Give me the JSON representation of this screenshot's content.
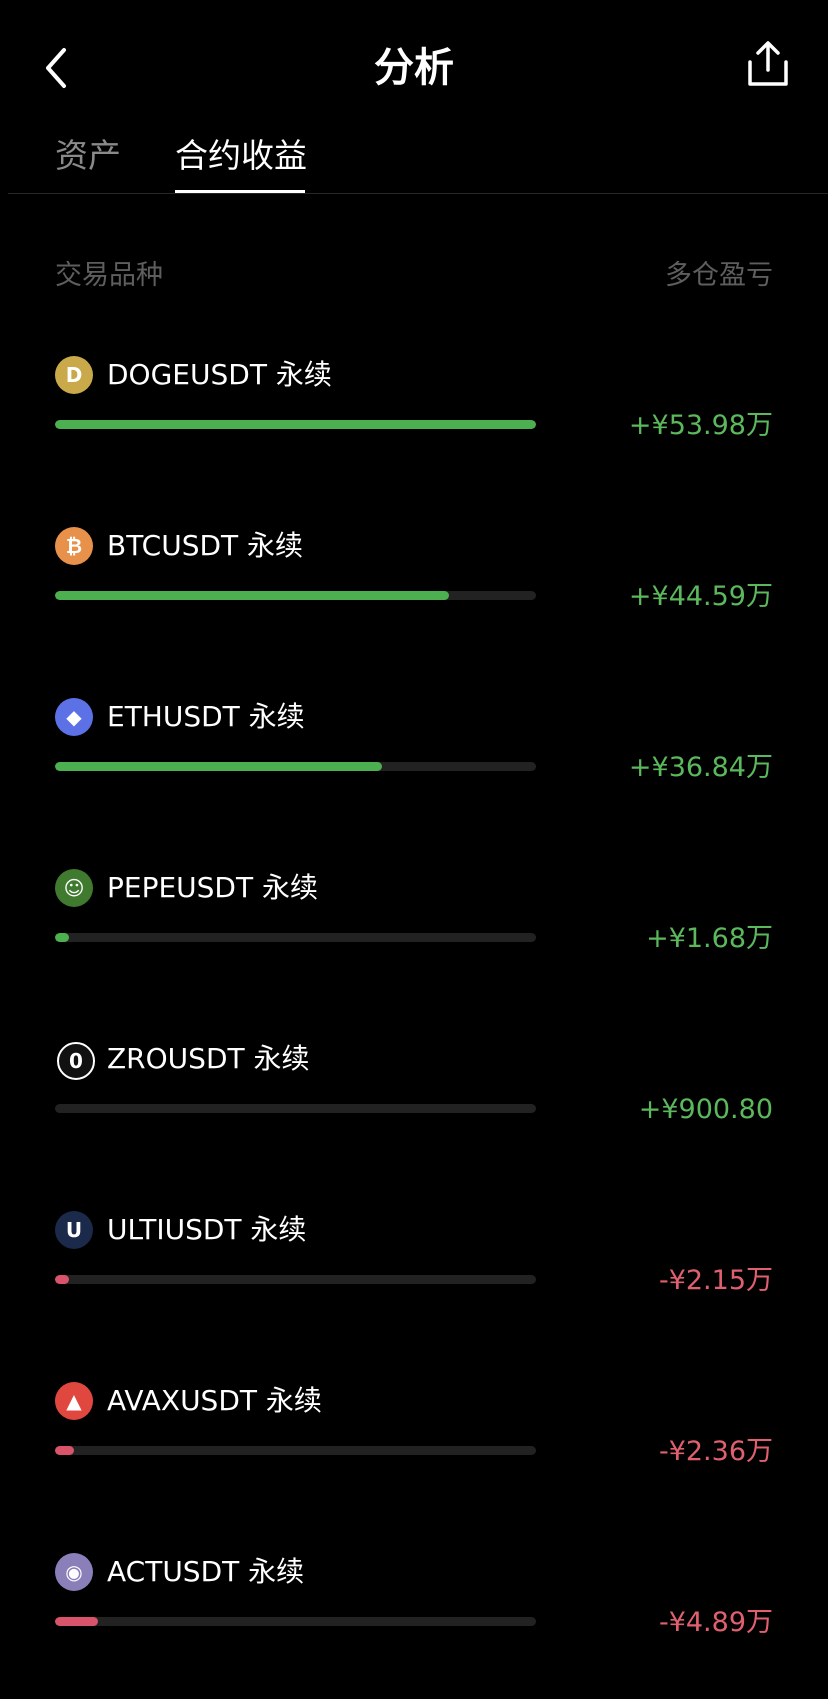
{
  "header": {
    "title": "分析",
    "back_icon": "chevron-left-icon",
    "share_icon": "share-icon"
  },
  "tabs": [
    {
      "label": "资产",
      "active": false
    },
    {
      "label": "合约收益",
      "active": true
    }
  ],
  "columns": {
    "left": "交易品种",
    "right": "多仓盈亏"
  },
  "colors": {
    "positive": "#4caf50",
    "negative": "#d9536b",
    "positive_text": "#5cb85c",
    "negative_text": "#e0606f",
    "track": "#222222"
  },
  "items": [
    {
      "name": "DOGEUSDT 永续",
      "pnl": "+¥53.98万",
      "sign": "positive",
      "fraction": 1.0,
      "icon": "doge-coin-icon",
      "icon_color": "#c9a94a",
      "icon_glyph": "D"
    },
    {
      "name": "BTCUSDT 永续",
      "pnl": "+¥44.59万",
      "sign": "positive",
      "fraction": 0.82,
      "icon": "bitcoin-icon",
      "icon_color": "#e8914a",
      "icon_glyph": "₿"
    },
    {
      "name": "ETHUSDT 永续",
      "pnl": "+¥36.84万",
      "sign": "positive",
      "fraction": 0.68,
      "icon": "ethereum-icon",
      "icon_color": "#5d71e6",
      "icon_glyph": "◆"
    },
    {
      "name": "PEPEUSDT 永续",
      "pnl": "+¥1.68万",
      "sign": "positive",
      "fraction": 0.03,
      "icon": "pepe-frog-icon",
      "icon_color": "#3f7a2f",
      "icon_glyph": "☺"
    },
    {
      "name": "ZROUSDT 永续",
      "pnl": "+¥900.80",
      "sign": "positive",
      "fraction": 0.0,
      "icon": "zro-icon",
      "icon_color": "#111111",
      "icon_glyph": "0"
    },
    {
      "name": "ULTIUSDT 永续",
      "pnl": "-¥2.15万",
      "sign": "negative",
      "fraction": 0.03,
      "icon": "ulti-icon",
      "icon_color": "#1b2a4a",
      "icon_glyph": "U"
    },
    {
      "name": "AVAXUSDT 永续",
      "pnl": "-¥2.36万",
      "sign": "negative",
      "fraction": 0.04,
      "icon": "avalanche-icon",
      "icon_color": "#e0483f",
      "icon_glyph": "▲"
    },
    {
      "name": "ACTUSDT 永续",
      "pnl": "-¥4.89万",
      "sign": "negative",
      "fraction": 0.09,
      "icon": "act-anime-icon",
      "icon_color": "#8a7fb8",
      "icon_glyph": "◉"
    }
  ]
}
